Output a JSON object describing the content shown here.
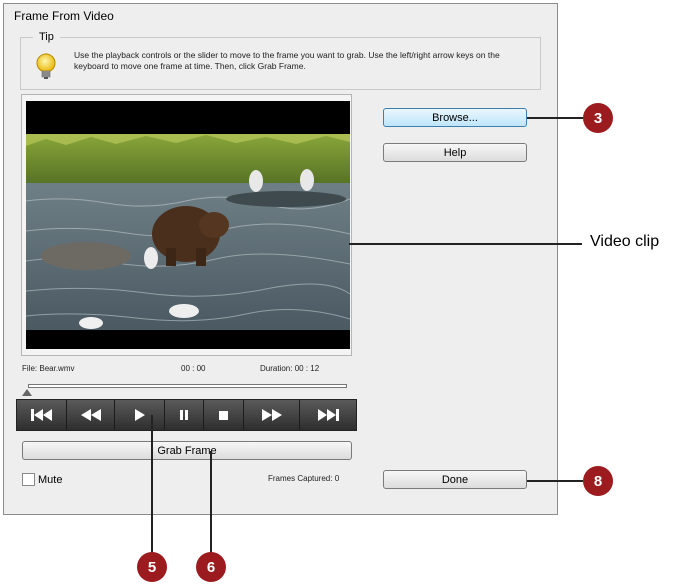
{
  "window": {
    "title": "Frame From Video"
  },
  "tip": {
    "legend": "Tip",
    "text": "Use the playback controls or the slider to move to the frame you want to grab. Use the left/right arrow keys on the keyboard to move one frame at time. Then, click Grab Frame.",
    "icon": "lightbulb-icon"
  },
  "video": {
    "file_label": "File:",
    "file_name": "Bear.wmv",
    "position": "00 : 00",
    "duration_label": "Duration:",
    "duration": "00 : 12",
    "slider_position": 0
  },
  "transport": {
    "buttons": [
      "skip-to-start-icon",
      "rewind-icon",
      "play-icon",
      "pause-icon",
      "stop-icon",
      "fast-forward-icon",
      "skip-to-end-icon"
    ]
  },
  "buttons": {
    "browse": "Browse...",
    "help": "Help",
    "grab_frame": "Grab Frame",
    "done": "Done"
  },
  "mute": {
    "label": "Mute",
    "checked": false
  },
  "frames_captured": {
    "label": "Frames Captured:",
    "count": "0"
  },
  "callouts": {
    "browse": "3",
    "video_clip": "Video clip",
    "play": "5",
    "grab_frame": "6",
    "done": "8"
  },
  "colors": {
    "callout": "#9b1b1e",
    "dialog_bg": "#eeeeee",
    "focused_button": "#bee6fd"
  }
}
